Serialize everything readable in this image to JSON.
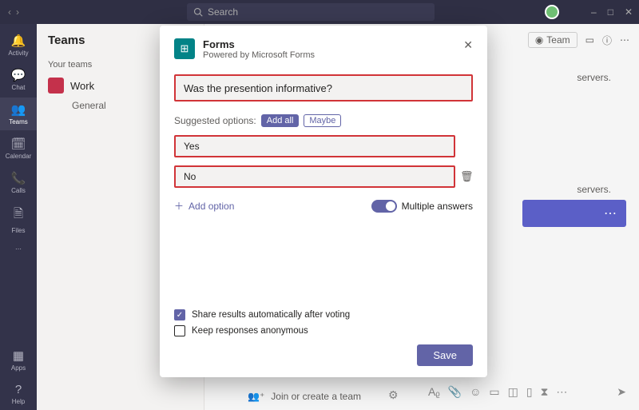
{
  "titlebar": {
    "search_placeholder": "Search"
  },
  "leftrail": {
    "items": [
      {
        "label": "Activity"
      },
      {
        "label": "Chat"
      },
      {
        "label": "Teams"
      },
      {
        "label": "Calendar"
      },
      {
        "label": "Calls"
      },
      {
        "label": "Files"
      }
    ],
    "apps": "Apps",
    "help": "Help"
  },
  "teams_panel": {
    "title": "Teams",
    "subhead": "Your teams",
    "team_name": "Work",
    "channel": "General",
    "join": "Join or create a team"
  },
  "header_right": {
    "team_chip": "Team"
  },
  "background_msgs": {
    "hint1": "servers.",
    "hint2": "servers."
  },
  "modal": {
    "app_name": "Forms",
    "subtitle": "Powered by Microsoft Forms",
    "question": "Was the presention informative?",
    "suggested_label": "Suggested options:",
    "suggested_add_all": "Add all",
    "suggested_maybe": "Maybe",
    "options": [
      "Yes",
      "No"
    ],
    "add_option": "Add option",
    "multiple_answers": "Multiple answers",
    "share_results": "Share results automatically after voting",
    "keep_anon": "Keep responses anonymous",
    "save": "Save"
  }
}
